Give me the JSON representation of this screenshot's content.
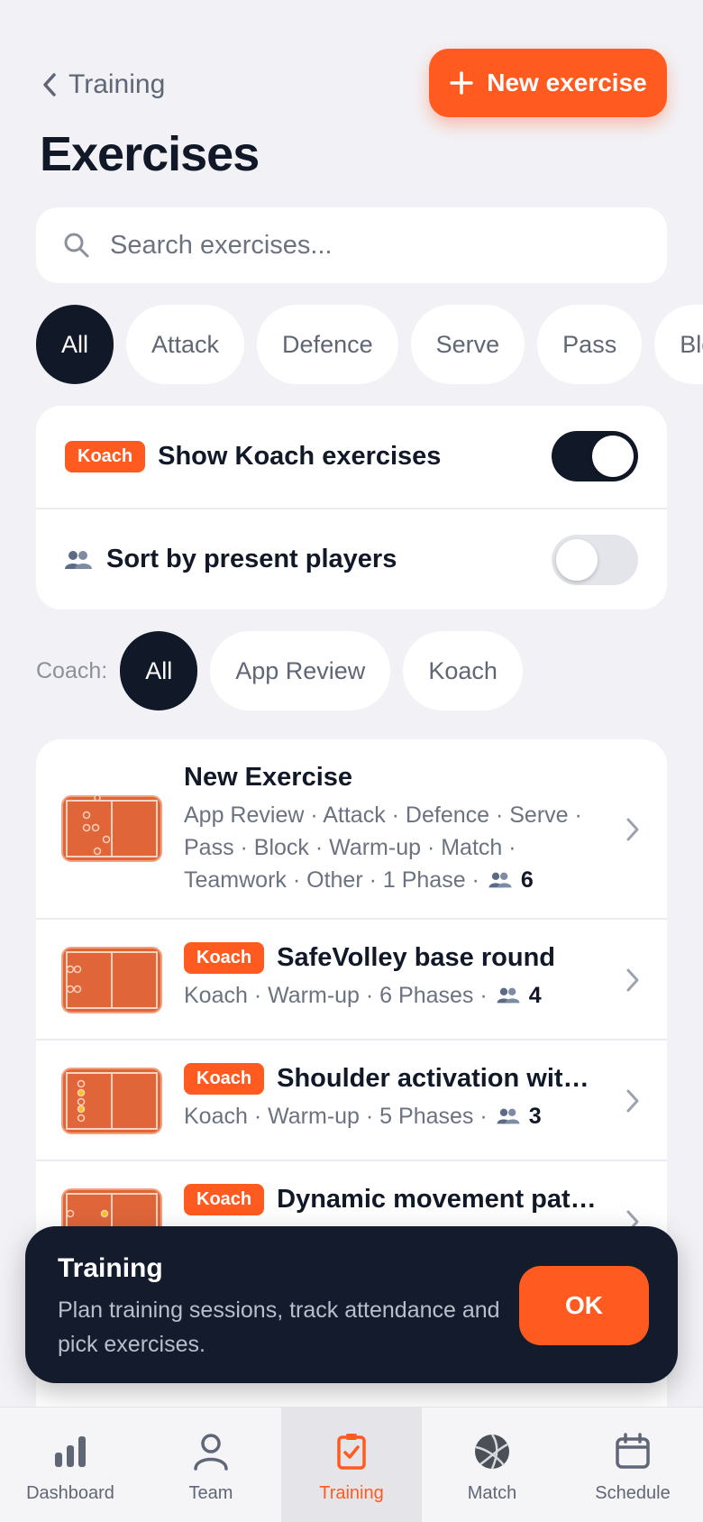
{
  "header": {
    "back_label": "Training",
    "new_button_label": "New exercise",
    "title": "Exercises"
  },
  "search": {
    "placeholder": "Search exercises..."
  },
  "category_chips": [
    {
      "label": "All",
      "active": true
    },
    {
      "label": "Attack",
      "active": false
    },
    {
      "label": "Defence",
      "active": false
    },
    {
      "label": "Serve",
      "active": false
    },
    {
      "label": "Pass",
      "active": false
    },
    {
      "label": "Block",
      "active": false
    }
  ],
  "toggles": {
    "show_koach": {
      "badge": "Koach",
      "label": "Show Koach exercises",
      "on": true
    },
    "sort_present": {
      "label": "Sort by present players",
      "on": false
    }
  },
  "coach_filter": {
    "label": "Coach:",
    "options": [
      {
        "label": "All",
        "active": true
      },
      {
        "label": "App Review",
        "active": false
      },
      {
        "label": "Koach",
        "active": false
      }
    ]
  },
  "exercises": [
    {
      "title": "New Exercise",
      "badge": "",
      "meta_line1": "App Review · Attack · Defence · Serve ·",
      "meta_line2": "Pass · Block · Warm-up · Match ·",
      "meta_line3": "Teamwork · Other · 1 Phase ·",
      "players": "6"
    },
    {
      "title": "SafeVolley base round",
      "badge": "Koach",
      "meta_line1": "Koach · Warm-up · 6 Phases ·",
      "players": "4"
    },
    {
      "title": "Shoulder activation with ...",
      "badge": "Koach",
      "meta_line1": "Koach · Warm-up · 5 Phases ·",
      "players": "3"
    },
    {
      "title": "Dynamic movement patte...",
      "badge": "Koach",
      "meta_line1": "",
      "players": ""
    }
  ],
  "toast": {
    "title": "Training",
    "text": "Plan training sessions, track attendance and pick exercises.",
    "ok_label": "OK"
  },
  "tabbar": [
    {
      "label": "Dashboard",
      "icon": "bar-chart-icon",
      "active": false
    },
    {
      "label": "Team",
      "icon": "person-icon",
      "active": false
    },
    {
      "label": "Training",
      "icon": "clipboard-check-icon",
      "active": true
    },
    {
      "label": "Match",
      "icon": "volleyball-icon",
      "active": false
    },
    {
      "label": "Schedule",
      "icon": "calendar-icon",
      "active": false
    }
  ],
  "colors": {
    "accent": "#ff5a1f",
    "dark": "#111827",
    "court": "#e0663a"
  }
}
